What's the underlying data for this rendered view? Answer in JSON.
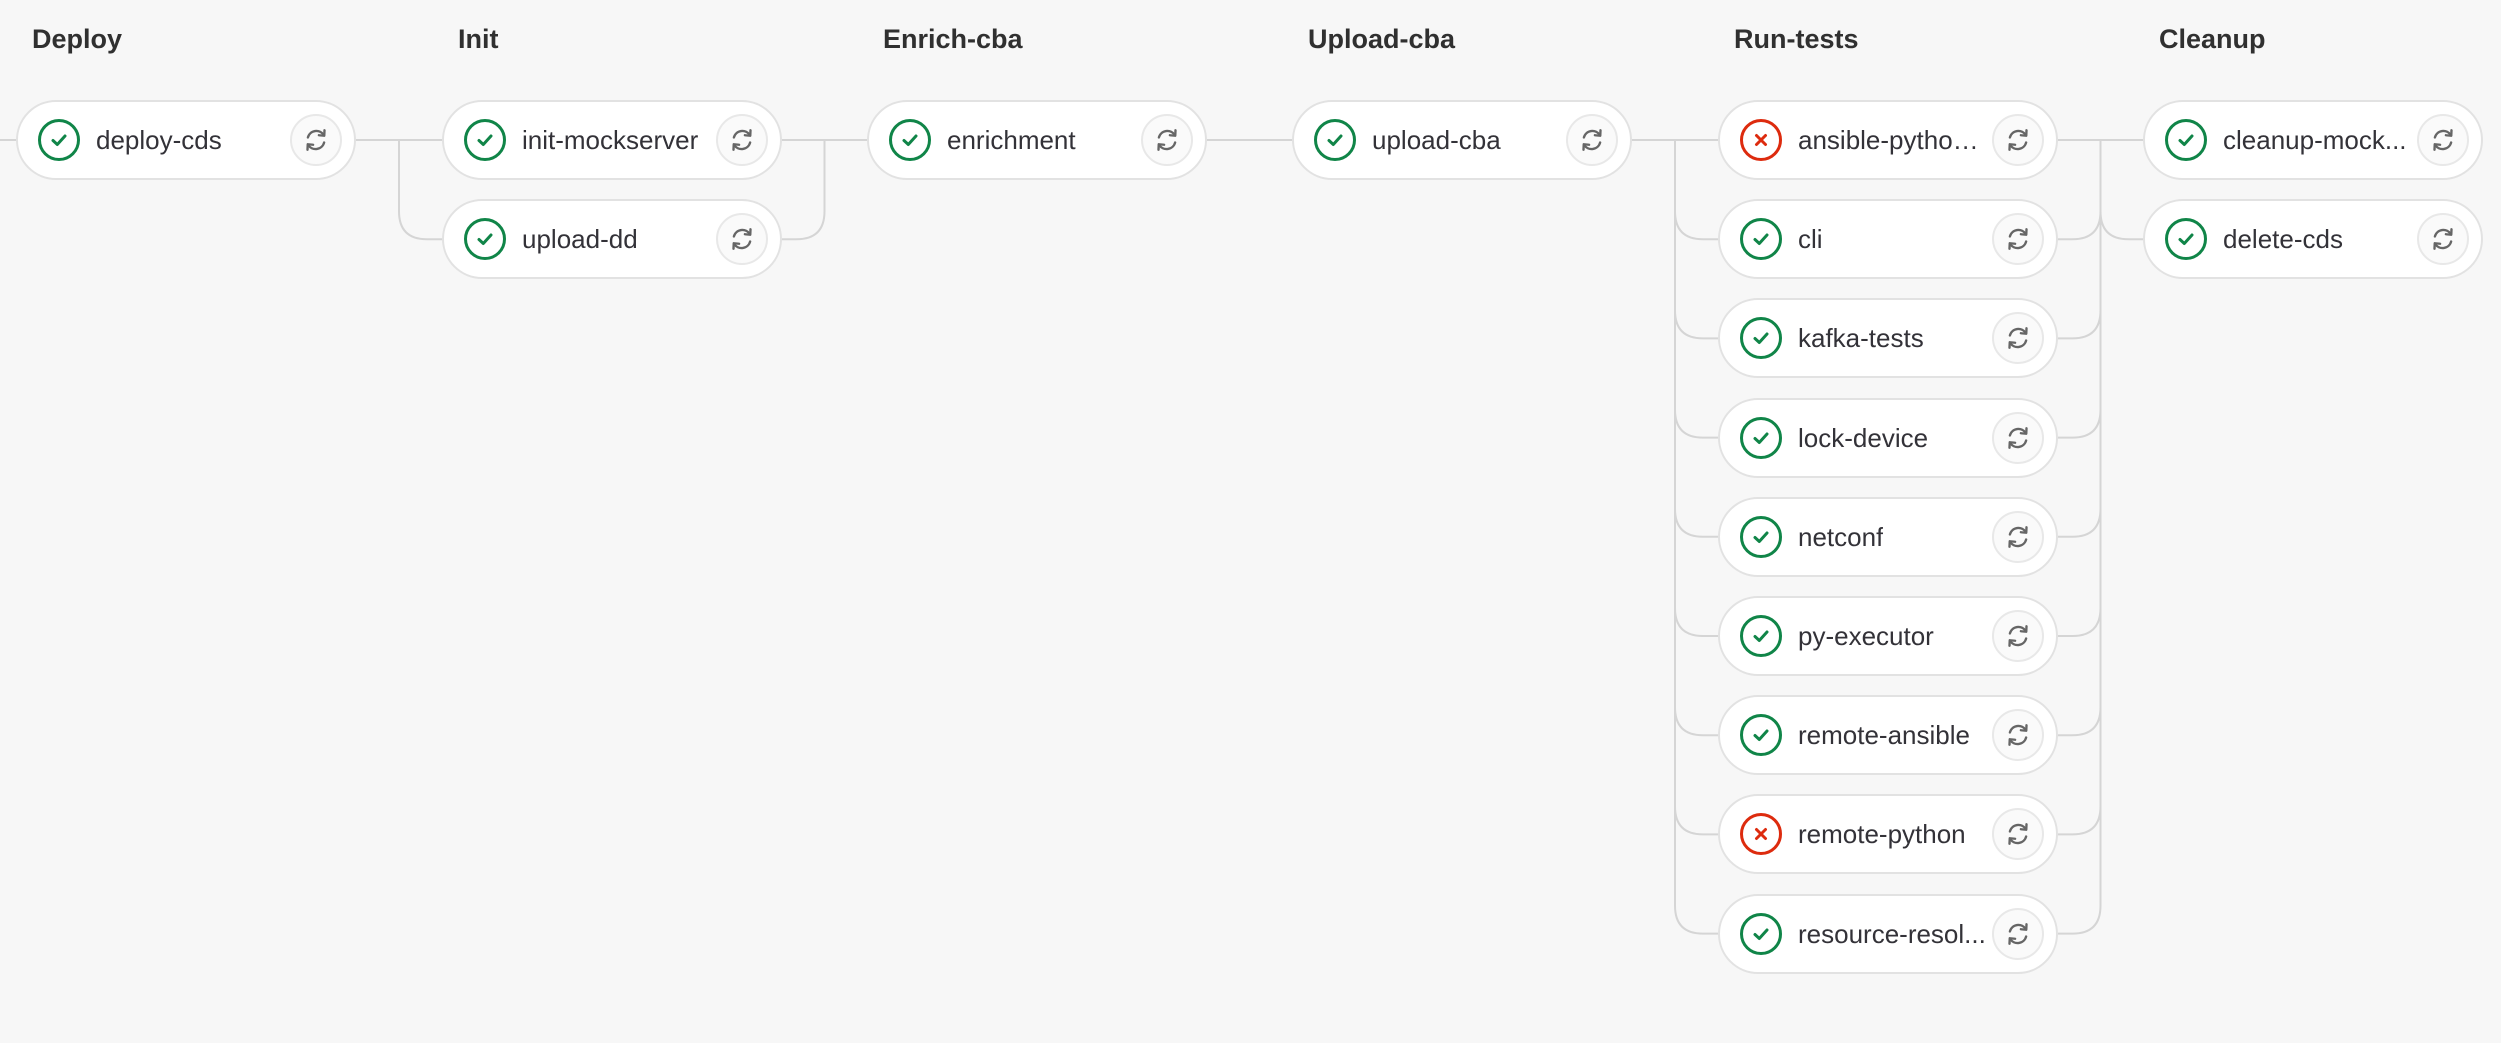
{
  "stages": [
    {
      "title": "Deploy",
      "jobs": [
        {
          "name": "deploy-cds",
          "status": "success",
          "status_icon": "check-circle-icon",
          "action_icon": "retry-icon"
        }
      ]
    },
    {
      "title": "Init",
      "jobs": [
        {
          "name": "init-mockserver",
          "status": "success",
          "status_icon": "check-circle-icon",
          "action_icon": "retry-icon"
        },
        {
          "name": "upload-dd",
          "status": "success",
          "status_icon": "check-circle-icon",
          "action_icon": "retry-icon"
        }
      ]
    },
    {
      "title": "Enrich-cba",
      "jobs": [
        {
          "name": "enrichment",
          "status": "success",
          "status_icon": "check-circle-icon",
          "action_icon": "retry-icon"
        }
      ]
    },
    {
      "title": "Upload-cba",
      "jobs": [
        {
          "name": "upload-cba",
          "status": "success",
          "status_icon": "check-circle-icon",
          "action_icon": "retry-icon"
        }
      ]
    },
    {
      "title": "Run-tests",
      "jobs": [
        {
          "name": "ansible-python...",
          "status": "failed",
          "status_icon": "x-circle-icon",
          "action_icon": "retry-icon"
        },
        {
          "name": "cli",
          "status": "success",
          "status_icon": "check-circle-icon",
          "action_icon": "retry-icon"
        },
        {
          "name": "kafka-tests",
          "status": "success",
          "status_icon": "check-circle-icon",
          "action_icon": "retry-icon"
        },
        {
          "name": "lock-device",
          "status": "success",
          "status_icon": "check-circle-icon",
          "action_icon": "retry-icon"
        },
        {
          "name": "netconf",
          "status": "success",
          "status_icon": "check-circle-icon",
          "action_icon": "retry-icon"
        },
        {
          "name": "py-executor",
          "status": "success",
          "status_icon": "check-circle-icon",
          "action_icon": "retry-icon"
        },
        {
          "name": "remote-ansible",
          "status": "success",
          "status_icon": "check-circle-icon",
          "action_icon": "retry-icon"
        },
        {
          "name": "remote-python",
          "status": "failed",
          "status_icon": "x-circle-icon",
          "action_icon": "retry-icon"
        },
        {
          "name": "resource-resol...",
          "status": "success",
          "status_icon": "check-circle-icon",
          "action_icon": "retry-icon"
        }
      ]
    },
    {
      "title": "Cleanup",
      "jobs": [
        {
          "name": "cleanup-mock...",
          "status": "success",
          "status_icon": "check-circle-icon",
          "action_icon": "retry-icon"
        },
        {
          "name": "delete-cds",
          "status": "success",
          "status_icon": "check-circle-icon",
          "action_icon": "retry-icon"
        }
      ]
    }
  ],
  "colors": {
    "success": "#108548",
    "failed": "#dd2b0e",
    "connector": "#d5d5d5",
    "stage_title": "#303030"
  }
}
